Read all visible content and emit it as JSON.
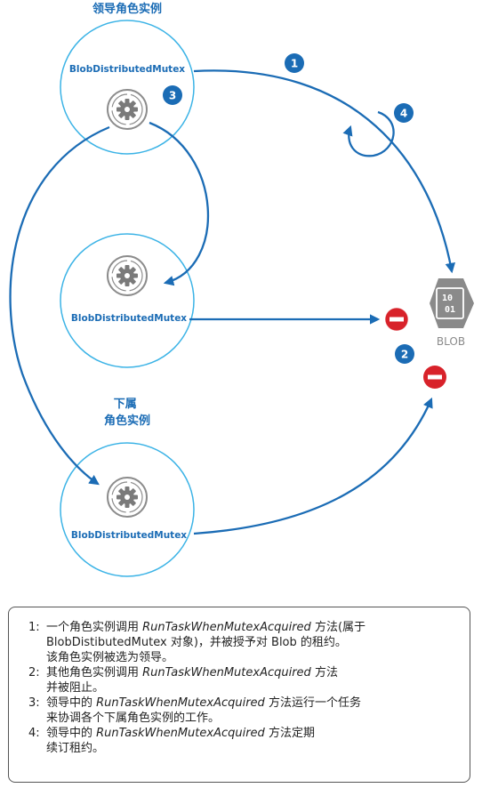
{
  "leader_title": "领导角色实例",
  "subordinate_title": "下属\n角色实例",
  "roles": [
    {
      "label": "BlobDistributedMutex"
    },
    {
      "label": "BlobDistributedMutex"
    },
    {
      "label": "BlobDistributedMutex"
    }
  ],
  "steps": [
    "1",
    "2",
    "3",
    "4"
  ],
  "blob": {
    "icon_text": "10\n01",
    "label": "BLOB"
  },
  "colors": {
    "circle": "#3bb3e6",
    "arrow": "#1b6cb5",
    "badge": "#1b6cb5",
    "stop": "#d8222a",
    "blob": "#8a8a8a"
  },
  "legend": [
    {
      "num": "1:",
      "lines": [
        [
          {
            "t": "一个角色实例调用 "
          },
          {
            "t": "RunTaskWhenMutexAcquired",
            "i": true
          },
          {
            "t": " 方法(属于"
          }
        ],
        [
          {
            "t": "BlobDistibutedMutex 对象)，并被授予对 Blob 的租约。"
          }
        ],
        [
          {
            "t": "该角色实例被选为领导。"
          }
        ]
      ]
    },
    {
      "num": "2:",
      "lines": [
        [
          {
            "t": "其他角色实例调用 "
          },
          {
            "t": "RunTaskWhenMutexAcquired",
            "i": true
          },
          {
            "t": " 方法"
          }
        ],
        [
          {
            "t": "并被阻止。"
          }
        ]
      ]
    },
    {
      "num": "3:",
      "lines": [
        [
          {
            "t": "领导中的 "
          },
          {
            "t": "RunTaskWhenMutexAcquired",
            "i": true
          },
          {
            "t": " 方法运行一个任务"
          }
        ],
        [
          {
            "t": "来协调各个下属角色实例的工作。"
          }
        ]
      ]
    },
    {
      "num": "4:",
      "lines": [
        [
          {
            "t": "领导中的 "
          },
          {
            "t": "RunTaskWhenMutexAcquired",
            "i": true
          },
          {
            "t": " 方法定期"
          }
        ],
        [
          {
            "t": "续订租约。"
          }
        ]
      ]
    }
  ]
}
